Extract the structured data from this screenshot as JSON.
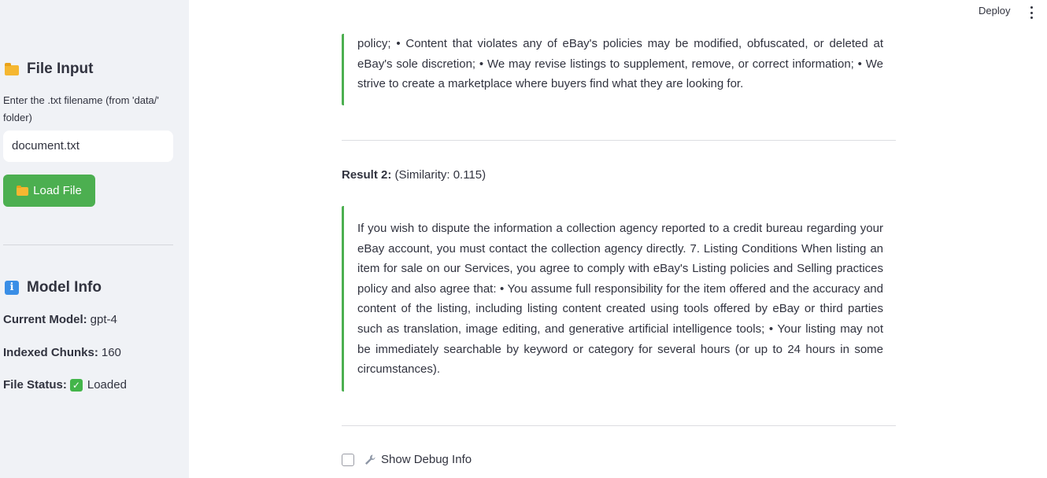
{
  "header": {
    "deploy_label": "Deploy"
  },
  "sidebar": {
    "file_input": {
      "title": "File Input",
      "input_label": "Enter the .txt filename (from 'data/' folder)",
      "input_value": "document.txt",
      "load_button_label": "Load File"
    },
    "model_info": {
      "title": "Model Info",
      "current_model_label": "Current Model:",
      "current_model_value": "gpt-4",
      "indexed_chunks_label": "Indexed Chunks:",
      "indexed_chunks_value": "160",
      "file_status_label": "File Status:",
      "file_status_value": "Loaded"
    }
  },
  "main": {
    "result1_text": "policy; • Content that violates any of eBay's policies may be modified, obfuscated, or deleted at eBay's sole discretion; • We may revise listings to supplement, remove, or correct information; • We strive to create a marketplace where buyers find what they are looking for.",
    "result2_label": "Result 2:",
    "result2_similarity": "(Similarity: 0.115)",
    "result2_text": "If you wish to dispute the information a collection agency reported to a credit bureau regarding your eBay account, you must contact the collection agency directly. 7. Listing Conditions When listing an item for sale on our Services, you agree to comply with eBay's Listing policies and Selling practices policy and also agree that: • You assume full responsibility for the item offered and the accuracy and content of the listing, including listing content created using tools offered by eBay or third parties such as translation, image editing, and generative artificial intelligence tools; • Your listing may not be immediately searchable by keyword or category for several hours (or up to 24 hours in some circumstances).",
    "debug_label": "Show Debug Info"
  },
  "colors": {
    "sidebar_bg": "#f0f2f6",
    "accent_green": "#4caf50",
    "text": "#31333f"
  },
  "icons": {
    "file_input": "folder-icon",
    "load_button": "folder-icon",
    "model_info": "info-icon",
    "file_status": "check-icon",
    "debug": "wrench-icon",
    "menu": "kebab-menu-icon"
  }
}
